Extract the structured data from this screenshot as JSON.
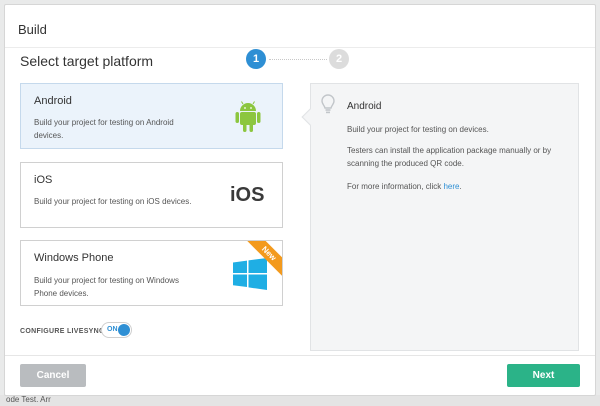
{
  "dialog": {
    "title": "Build",
    "subtitle": "Select target platform",
    "steps": [
      "1",
      "2"
    ]
  },
  "platforms": [
    {
      "title": "Android",
      "description": "Build your project for testing on Android devices.",
      "selected": true,
      "icon": "android-icon"
    },
    {
      "title": "iOS",
      "description": "Build your project for testing on iOS devices.",
      "selected": false,
      "icon": "ios-logo",
      "logo_text": "iOS"
    },
    {
      "title": "Windows Phone",
      "description": "Build your project for testing on Windows Phone devices.",
      "selected": false,
      "icon": "windows-icon",
      "badge": "New"
    }
  ],
  "livesync": {
    "label": "CONFIGURE LIVESYNC",
    "toggle_text": "ON"
  },
  "info": {
    "title": "Android",
    "p1": "Build your project for testing on devices.",
    "p2": "Testers can install the application package manually or by scanning the produced QR code.",
    "p3_prefix": "For more information, click ",
    "p3_link": "here",
    "p3_suffix": "."
  },
  "buttons": {
    "cancel": "Cancel",
    "next": "Next"
  },
  "background": {
    "fragment": "ode  Test. Arr"
  },
  "colors": {
    "accent": "#2e8fd4",
    "primary_button": "#2bb388",
    "secondary_button": "#b9bcbf",
    "android_green": "#8cc63f",
    "windows_blue": "#1faee4",
    "badge_orange": "#f39a1d"
  }
}
